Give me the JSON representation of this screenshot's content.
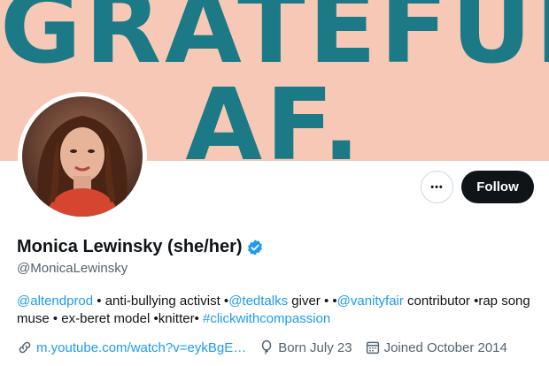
{
  "banner": {
    "line1": "GRATEFUL",
    "line2": "AF."
  },
  "colors": {
    "banner_bg": "#f7c8b6",
    "banner_text": "#1b7a85",
    "link": "#1d9bf0",
    "verified": "#1d9bf0",
    "follow_bg": "#0f1419"
  },
  "actions": {
    "more_label": "•••",
    "follow_label": "Follow"
  },
  "profile": {
    "name": "Monica Lewinsky (she/her)",
    "handle": "@MonicaLewinsky",
    "verified_icon": "verified-badge-icon"
  },
  "bio": {
    "link1": "@altendprod",
    "text1": " • anti-bullying activist •",
    "link2": "@tedtalks",
    "text2": " giver • •",
    "link3": "@vanityfair",
    "text3": " contributor •rap song muse • ex-beret model •knitter• ",
    "link4": "#clickwithcompassion"
  },
  "meta": {
    "url": "m.youtube.com/watch?v=eykBgE…",
    "born": "Born July 23",
    "joined": "Joined October 2014",
    "icons": [
      "link-icon",
      "balloon-icon",
      "calendar-icon"
    ]
  }
}
